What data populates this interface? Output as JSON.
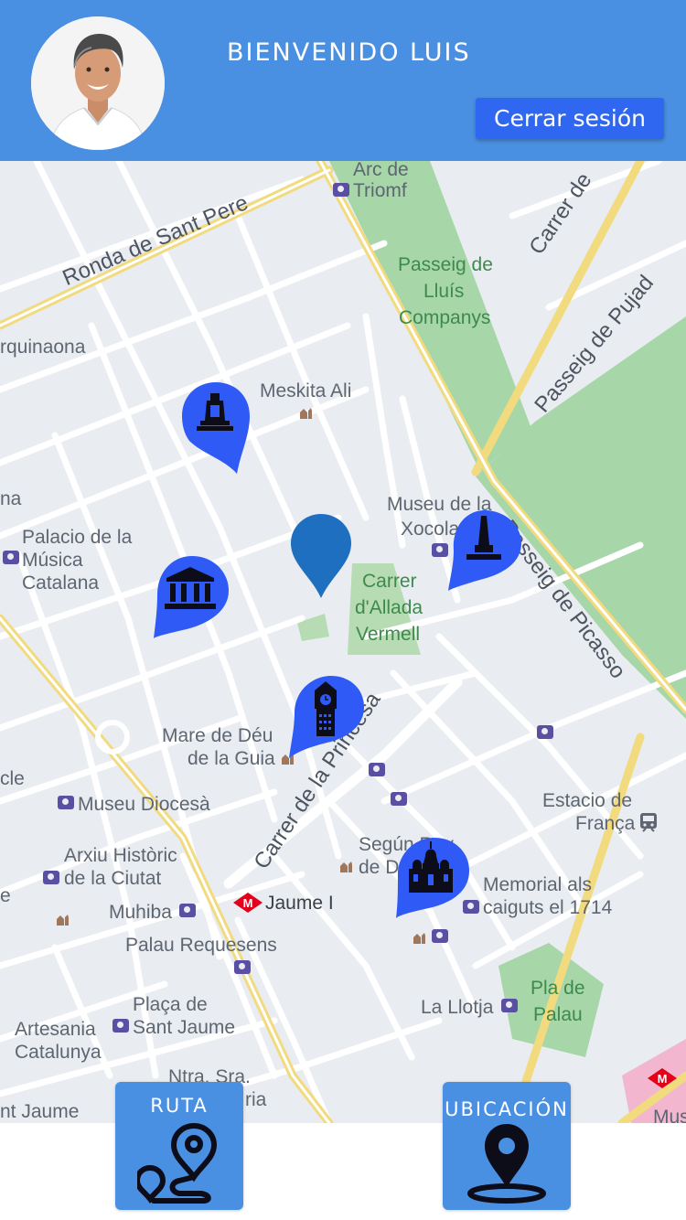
{
  "header": {
    "welcome_text": "BIENVENIDO LUIS",
    "logout_label": "Cerrar sesión",
    "background_color": "#4a90e2",
    "logout_color": "#2f67f0"
  },
  "map": {
    "labels": {
      "arc_de_triomf_1": "Arc de",
      "arc_de_triomf_2": "Triomf",
      "ronda_sant_pere": "Ronda de Sant Pere",
      "carrer_de": "Carrer de",
      "passeig_lluis_1": "Passeig de",
      "passeig_lluis_2": "Lluís",
      "passeig_lluis_3": "Companys",
      "passeig_pujades": "Passeig de Pujad",
      "urquinaona": "rquinaona",
      "meskita_ali": "Meskita Ali",
      "na": "na",
      "museu_xocolata_1": "Museu de la",
      "museu_xocolata_2": "Xocola",
      "palau_musica_1": "Palacio de la",
      "palau_musica_2": "Música",
      "palau_musica_3": "Catalana",
      "passeig_picasso": "Passeig de Picasso",
      "carrer_allada_1": "Carrer",
      "carrer_allada_2": "d'Allada",
      "carrer_allada_3": "Vermell",
      "mare_deu_1": "Mare de Déu",
      "mare_deu_2": "de la Guia",
      "carrer_princesa": "Carrer de la Princesa",
      "cle": "cle",
      "museu_diocesa": "Museu Diocesà",
      "estacio_1": "Estacio de",
      "estacio_2": "França",
      "arxiu_1": "Arxiu Històric",
      "arxiu_2": "de la Ciutat",
      "segun_1": "Según Rey",
      "segun_2": "de D",
      "muhiba": "Muhiba",
      "jaume_i": "Jaume I",
      "memorial_1": "Memorial als",
      "memorial_2": "caiguts el 1714",
      "palau_requesens": "Palau Requesens",
      "placa_1": "Plaça de",
      "placa_2": "Sant Jaume",
      "pla_palau_1": "Pla de",
      "pla_palau_2": "Palau",
      "la_llotja": "La Llotja",
      "artesania_1": "Artesania",
      "artesania_2": "Catalunya",
      "ntra_sra": "Ntra. Sra.",
      "ria": "ria",
      "nt_jaume": "nt Jaume",
      "mus": "Mus",
      "metro": "M"
    },
    "markers": [
      {
        "name": "monument-marker",
        "icon": "monument-icon",
        "color": "#2f5af5"
      },
      {
        "name": "obelisk-marker",
        "icon": "obelisk-icon",
        "color": "#2f5af5"
      },
      {
        "name": "museum-marker",
        "icon": "museum-icon",
        "color": "#2f5af5"
      },
      {
        "name": "clock-tower-marker",
        "icon": "clock-tower-icon",
        "color": "#2f5af5"
      },
      {
        "name": "cathedral-marker",
        "icon": "cathedral-icon",
        "color": "#2f5af5"
      },
      {
        "name": "current-location-marker",
        "icon": "location-pin-icon",
        "color": "#1e6fbf"
      }
    ]
  },
  "actions": {
    "route_label": "RUTA",
    "location_label": "UBICACIÓN"
  }
}
